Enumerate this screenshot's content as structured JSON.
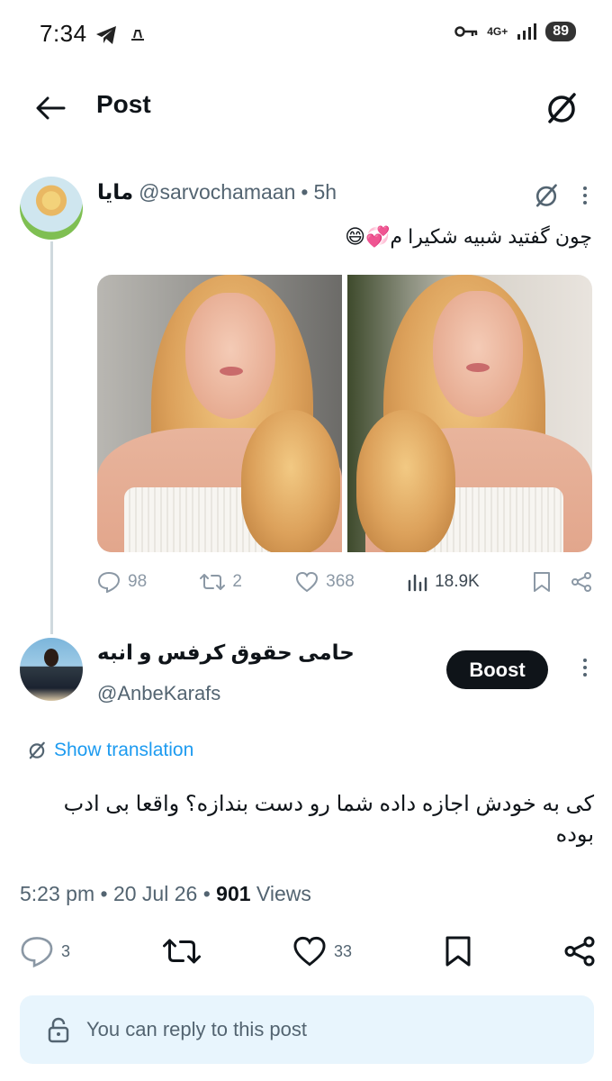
{
  "status_bar": {
    "time": "7:34",
    "network": "4G+",
    "battery": "89"
  },
  "header": {
    "title": "Post"
  },
  "parent_post": {
    "display_name": "مایا",
    "handle": "@sarvochamaan",
    "separator": "•",
    "time": "5h",
    "text": "چون گفتید شبیه شکیرا م💞😄",
    "stats": {
      "replies": "98",
      "reposts": "2",
      "likes": "368",
      "views": "18.9K"
    }
  },
  "reply": {
    "display_name": "حامی حقوق کرفس و انبه",
    "handle": "@AnbeKarafs",
    "boost_label": "Boost",
    "translate_label": "Show translation",
    "text": "کی به خودش اجازه داده شما رو دست بندازه؟ واقعا بی ادب بوده",
    "time": "5:23 pm",
    "date": "20 Jul 26",
    "views_count": "901",
    "views_label": "Views",
    "replies": "3",
    "likes": "33"
  },
  "reply_notice": {
    "text": "You can reply to this post"
  },
  "colors": {
    "accent": "#1d9bf0",
    "text_primary": "#0f1419",
    "text_secondary": "#536471",
    "reply_bar_bg": "#e8f5fd",
    "thread_line": "#cfd9de"
  }
}
